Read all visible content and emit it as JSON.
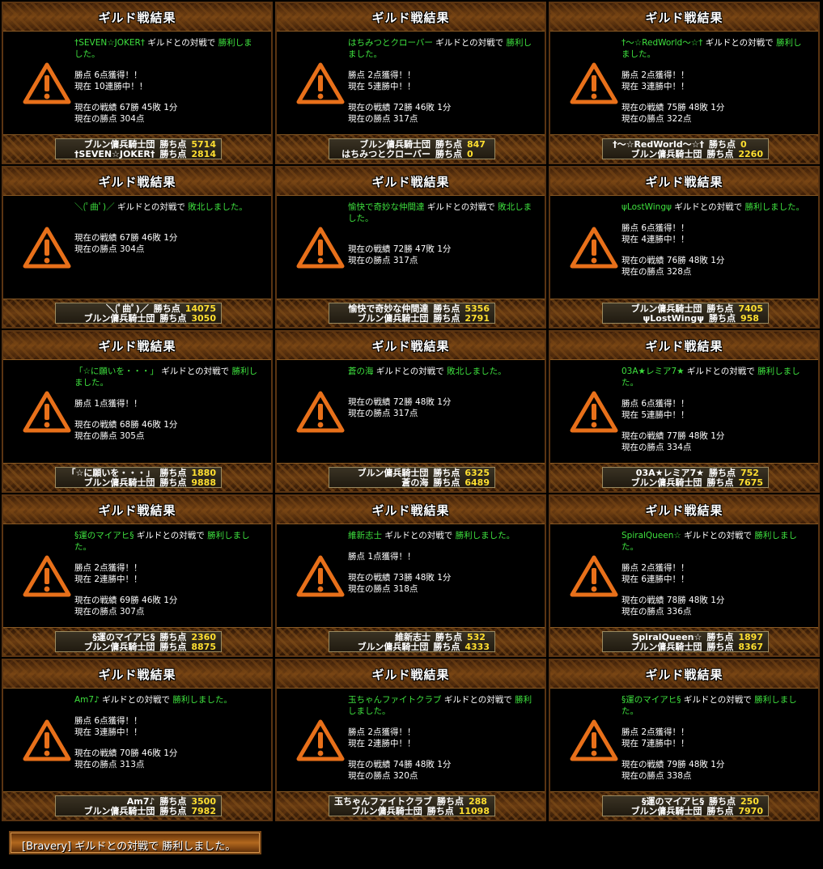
{
  "panel_title": "ギルド戦結果",
  "score_label": "勝ち点",
  "panels": [
    {
      "opp": "†SEVEN☆JOKER†",
      "suffix": " ギルドとの対戦で ",
      "result": "勝利しました。",
      "gain": "勝点 6点獲得！！",
      "streak": "現在 10連勝中！！",
      "record": "現在の戦績 67勝 45敗 1分",
      "points": "現在の勝点 304点",
      "score1_name": "ブルン傭兵騎士団",
      "score1": "5714",
      "score2_name": "†SEVEN☆JOKER†",
      "score2": "2814"
    },
    {
      "opp": "はちみつとクローバー",
      "suffix": " ギルドとの対戦で ",
      "result": "勝利しました。",
      "gain": "勝点 2点獲得！！",
      "streak": "現在 5連勝中！！",
      "record": "現在の戦績 72勝 46敗 1分",
      "points": "現在の勝点 317点",
      "score1_name": "ブルン傭兵騎士団",
      "score1": "847",
      "score2_name": "はちみつとクローバー",
      "score2": "0"
    },
    {
      "opp": "†～☆RedWorld～☆†",
      "suffix": " ギルドとの対戦で ",
      "result": "勝利しました。",
      "gain": "勝点 2点獲得！！",
      "streak": "現在 3連勝中！！",
      "record": "現在の戦績 75勝 48敗 1分",
      "points": "現在の勝点 322点",
      "score1_name": "†～☆RedWorld～☆†",
      "score1": "0",
      "score2_name": "ブルン傭兵騎士団",
      "score2": "2260"
    },
    {
      "opp": "＼(ﾟ曲ﾟ)／",
      "suffix": " ギルドとの対戦で ",
      "result": "敗北しました。",
      "gain": "",
      "streak": "",
      "record": "現在の戦績 67勝 46敗 1分",
      "points": "現在の勝点 304点",
      "score1_name": "＼(ﾟ曲ﾟ)／",
      "score1": "14075",
      "score2_name": "ブルン傭兵騎士団",
      "score2": "3050"
    },
    {
      "opp": "愉快で奇妙な仲間達",
      "suffix": " ギルドとの対戦で ",
      "result": "敗北しました。",
      "gain": "",
      "streak": "",
      "record": "現在の戦績 72勝 47敗 1分",
      "points": "現在の勝点 317点",
      "score1_name": "愉快で奇妙な仲間達",
      "score1": "5356",
      "score2_name": "ブルン傭兵騎士団",
      "score2": "2791"
    },
    {
      "opp": "ψLostWingψ",
      "suffix": " ギルドとの対戦で ",
      "result": "勝利しました。",
      "gain": "勝点 6点獲得！！",
      "streak": "現在 4連勝中！！",
      "record": "現在の戦績 76勝 48敗 1分",
      "points": "現在の勝点 328点",
      "score1_name": "ブルン傭兵騎士団",
      "score1": "7405",
      "score2_name": "ψLostWingψ",
      "score2": "958"
    },
    {
      "opp": "「☆に願いを・・・」",
      "suffix": " ギルドとの対戦で ",
      "result": "勝利しました。",
      "gain": "勝点 1点獲得！！",
      "streak": "",
      "record": "現在の戦績 68勝 46敗 1分",
      "points": "現在の勝点 305点",
      "score1_name": "「☆に願いを・・・」",
      "score1": "1880",
      "score2_name": "ブルン傭兵騎士団",
      "score2": "9888"
    },
    {
      "opp": "蒼の海",
      "suffix": " ギルドとの対戦で ",
      "result": "敗北しました。",
      "gain": "",
      "streak": "",
      "record": "現在の戦績 72勝 48敗 1分",
      "points": "現在の勝点 317点",
      "score1_name": "ブルン傭兵騎士団",
      "score1": "6325",
      "score2_name": "蒼の海",
      "score2": "6489"
    },
    {
      "opp": "03A★レミア7★",
      "suffix": " ギルドとの対戦で ",
      "result": "勝利しました。",
      "gain": "勝点 6点獲得！！",
      "streak": "現在 5連勝中！！",
      "record": "現在の戦績 77勝 48敗 1分",
      "points": "現在の勝点 334点",
      "score1_name": "03A★レミア7★",
      "score1": "752",
      "score2_name": "ブルン傭兵騎士団",
      "score2": "7675"
    },
    {
      "opp": "§運のマイアヒ§",
      "suffix": " ギルドとの対戦で ",
      "result": "勝利しました。",
      "gain": "勝点 2点獲得！！",
      "streak": "現在 2連勝中！！",
      "record": "現在の戦績 69勝 46敗 1分",
      "points": "現在の勝点 307点",
      "score1_name": "§運のマイアヒ§",
      "score1": "2360",
      "score2_name": "ブルン傭兵騎士団",
      "score2": "8875"
    },
    {
      "opp": "維新志士",
      "suffix": " ギルドとの対戦で ",
      "result": "勝利しました。",
      "gain": "勝点 1点獲得！！",
      "streak": "",
      "record": "現在の戦績 73勝 48敗 1分",
      "points": "現在の勝点 318点",
      "score1_name": "維新志士",
      "score1": "532",
      "score2_name": "ブルン傭兵騎士団",
      "score2": "4333"
    },
    {
      "opp": "SpiralQueen☆",
      "suffix": " ギルドとの対戦で ",
      "result": "勝利しました。",
      "gain": "勝点 2点獲得！！",
      "streak": "現在 6連勝中！！",
      "record": "現在の戦績 78勝 48敗 1分",
      "points": "現在の勝点 336点",
      "score1_name": "SpiralQueen☆",
      "score1": "1897",
      "score2_name": "ブルン傭兵騎士団",
      "score2": "8367"
    },
    {
      "opp": "Am7♪",
      "suffix": " ギルドとの対戦で ",
      "result": "勝利しました。",
      "gain": "勝点 6点獲得！！",
      "streak": "現在 3連勝中！！",
      "record": "現在の戦績 70勝 46敗 1分",
      "points": "現在の勝点 313点",
      "score1_name": "Am7♪",
      "score1": "3500",
      "score2_name": "ブルン傭兵騎士団",
      "score2": "7982"
    },
    {
      "opp": "玉ちゃんファイトクラブ",
      "suffix": " ギルドとの対戦で ",
      "result": "勝利しました。",
      "gain": "勝点 2点獲得！！",
      "streak": "現在 2連勝中！！",
      "record": "現在の戦績 74勝 48敗 1分",
      "points": "現在の勝点 320点",
      "score1_name": "玉ちゃんファイトクラブ",
      "score1": "288",
      "score2_name": "ブルン傭兵騎士団",
      "score2": "11098"
    },
    {
      "opp": "§運のマイアヒ§",
      "suffix": " ギルドとの対戦で ",
      "result": "勝利しました。",
      "gain": "勝点 2点獲得！！",
      "streak": "現在 7連勝中！！",
      "record": "現在の戦績 79勝 48敗 1分",
      "points": "現在の勝点 338点",
      "score1_name": "§運のマイアヒ§",
      "score1": "250",
      "score2_name": "ブルン傭兵騎士団",
      "score2": "7970"
    }
  ],
  "banner": "[Bravery] ギルドとの対戦で 勝利しました。",
  "colors": {
    "accent_green": "#3ee03e",
    "score_yellow": "#ffdf30",
    "warning_orange": "#e8701a"
  }
}
